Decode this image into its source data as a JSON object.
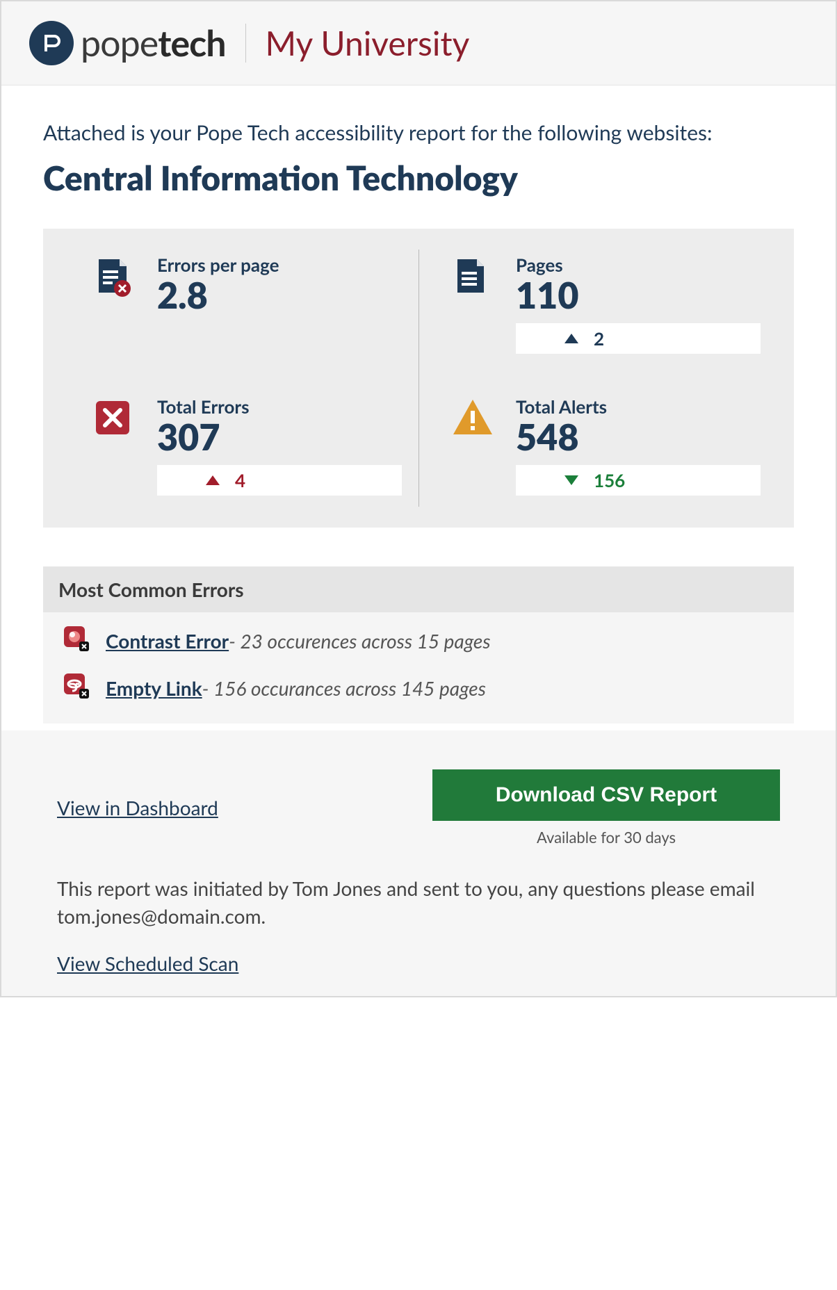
{
  "header": {
    "brand_pope": "pope",
    "brand_tech": "tech",
    "org_name": "My University"
  },
  "intro": "Attached is your Pope Tech accessibility report for the following websites:",
  "site_title": "Central Information Technology",
  "metrics": {
    "errors_per_page": {
      "label": "Errors per page",
      "value": "2.8"
    },
    "pages": {
      "label": "Pages",
      "value": "110",
      "delta": "2",
      "dir": "up-navy"
    },
    "total_errors": {
      "label": "Total Errors",
      "value": "307",
      "delta": "4",
      "dir": "up-red"
    },
    "total_alerts": {
      "label": "Total Alerts",
      "value": "548",
      "delta": "156",
      "dir": "down-green"
    }
  },
  "errors_section": {
    "heading": "Most Common Errors",
    "items": [
      {
        "name": "Contrast Error",
        "detail": " - 23 occurences across 15 pages"
      },
      {
        "name": "Empty Link",
        "detail": " - 156 occurances across 145 pages"
      }
    ]
  },
  "footer": {
    "view_dashboard": "View in Dashboard",
    "download_btn": "Download CSV Report",
    "download_note": "Available for 30 days",
    "body_text": "This report was initiated by Tom Jones and sent to you, any questions please email tom.jones@domain.com.",
    "view_scheduled": "View Scheduled Scan"
  }
}
